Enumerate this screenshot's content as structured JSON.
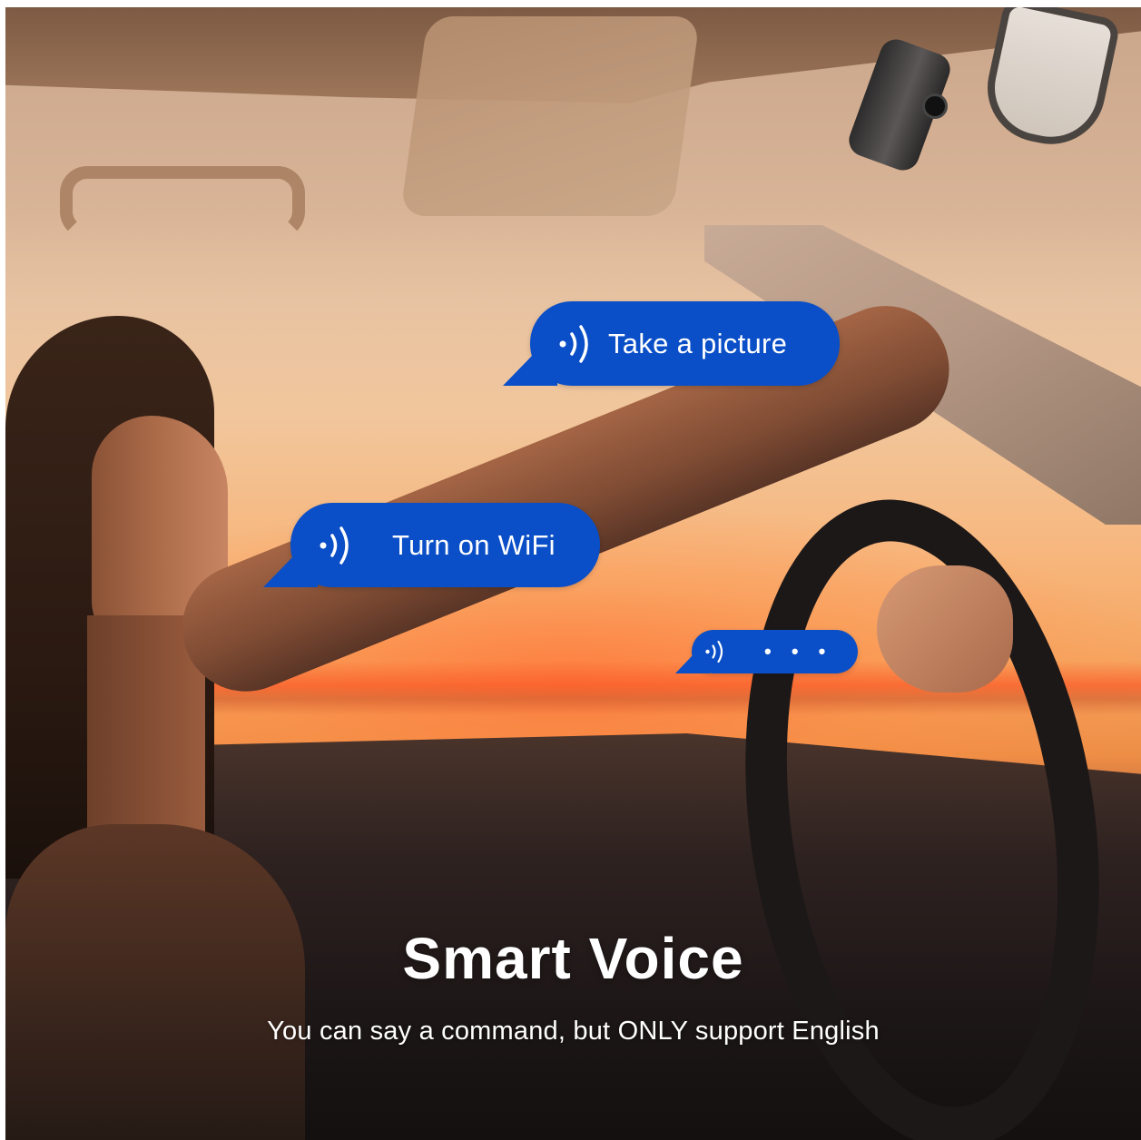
{
  "bubbles": {
    "first": {
      "text": "Take a picture",
      "icon": "voice-wave-icon"
    },
    "second": {
      "text": "Turn on WiFi",
      "icon": "voice-wave-icon"
    },
    "third": {
      "text": "• • •",
      "icon": "voice-wave-icon"
    }
  },
  "caption": {
    "headline": "Smart Voice",
    "subline": "You can say a command, but ONLY support English"
  },
  "colors": {
    "bubble": "#0a4fc7",
    "text": "#ffffff"
  }
}
